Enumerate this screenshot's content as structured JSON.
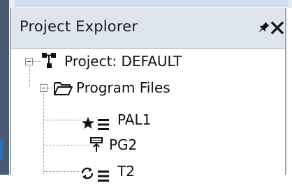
{
  "panel": {
    "title": "Project Explorer",
    "pin_glyph": "★",
    "close_glyph": "✕"
  },
  "tree": {
    "root": {
      "label": "Project: DEFAULT",
      "icon": "project-network-icon",
      "expanded": true
    },
    "folder": {
      "label": "Program Files",
      "icon": "folder-open-icon",
      "expanded": true
    },
    "items": [
      {
        "label": "PAL1",
        "icons": [
          "star-icon",
          "list-icon"
        ]
      },
      {
        "label": "PG2",
        "icons": [
          "pushbutton-icon"
        ]
      },
      {
        "label": "T2",
        "icons": [
          "cycle-icon",
          "list-icon"
        ]
      }
    ]
  },
  "colors": {
    "titlebar": "#dee5ed",
    "tree_lines": "#8a8a8a",
    "left_strip": "#4a5a73"
  }
}
